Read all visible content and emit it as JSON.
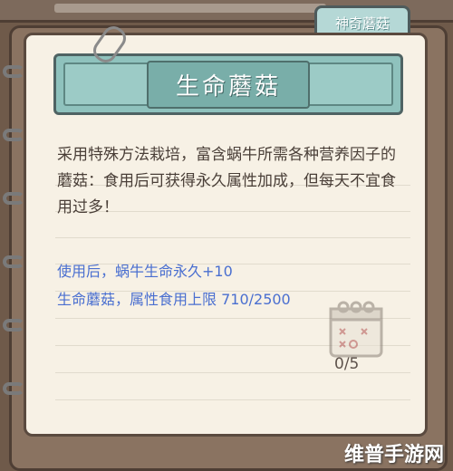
{
  "tab": {
    "label": "神奇蘑菇"
  },
  "item": {
    "title": "生命蘑菇",
    "description": "采用特殊方法栽培，富含蜗牛所需各种营养因子的蘑菇：食用后可获得永久属性加成，但每天不宜食用过多！",
    "effect_line_1": "使用后，蜗牛生命永久+10",
    "effect_line_2": "生命蘑菇，属性食用上限 710/2500",
    "daily_counter": "0/5"
  },
  "watermark": "维普手游网",
  "colors": {
    "accent_teal": "#8fc2bd",
    "effect_text": "#4a6fd0",
    "paper": "#f7f1e5"
  }
}
